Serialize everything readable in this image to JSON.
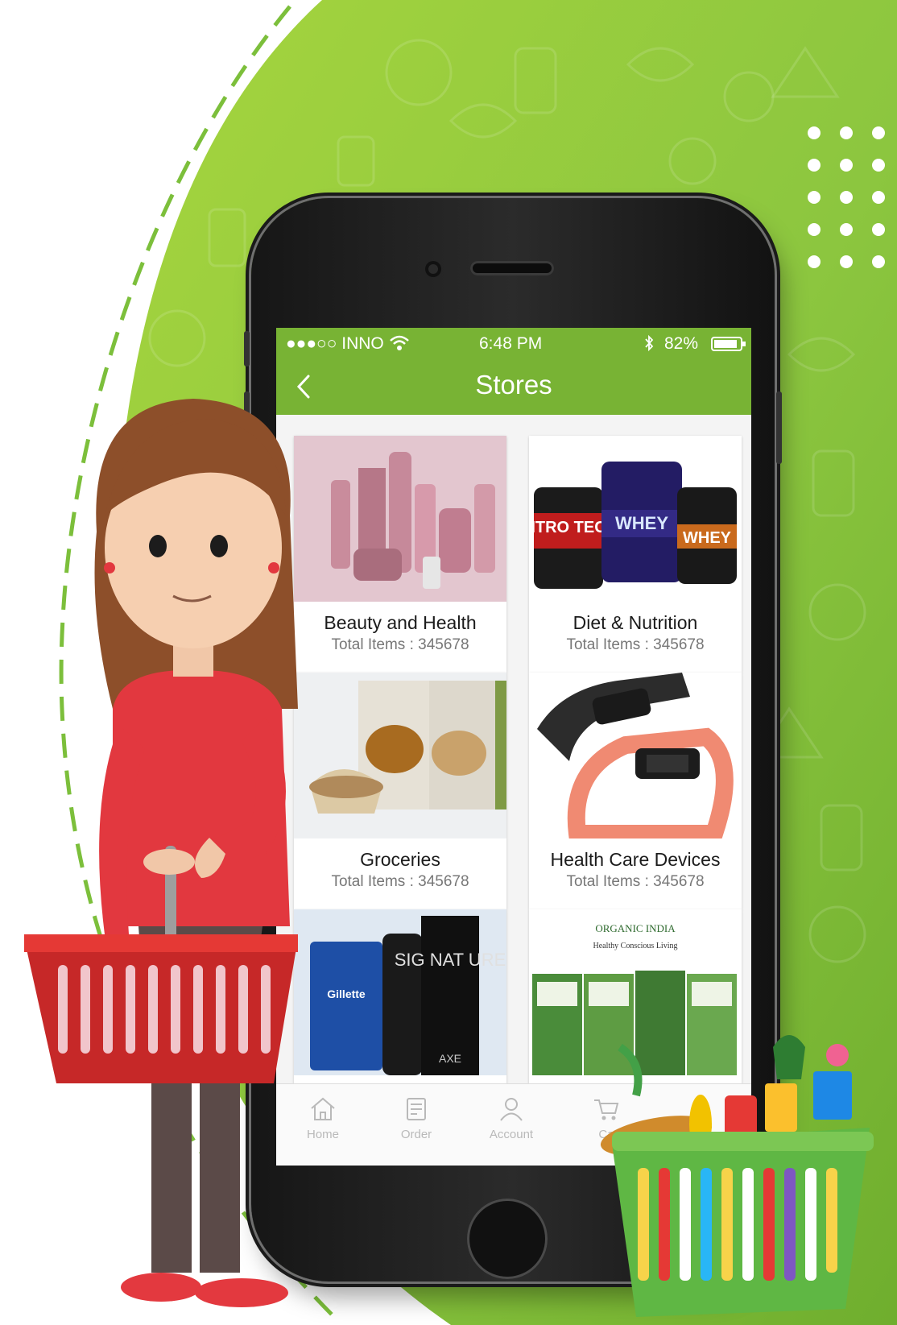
{
  "colors": {
    "brand_green": "#78b334",
    "background_green": "#8cc63f"
  },
  "status_bar": {
    "carrier": "●●●○○ INNO",
    "time": "6:48 PM",
    "battery": "82%"
  },
  "header": {
    "title": "Stores"
  },
  "stores": [
    {
      "name": "Beauty and Health",
      "count": "Total Items : 345678"
    },
    {
      "name": "Diet & Nutrition",
      "count": "Total Items : 345678"
    },
    {
      "name": "Groceries",
      "count": "Total Items : 345678"
    },
    {
      "name": "Health Care Devices",
      "count": "Total Items : 345678"
    }
  ],
  "product_labels": {
    "nitro": "NITRO TECH",
    "whey": "WHEY",
    "whey2": "WHEY",
    "signature": "SIG NAT URE",
    "axe": "AXE",
    "gillette": "Gillette",
    "organic_brand": "ORGANIC INDIA",
    "organic_tagline": "Healthy Conscious Living"
  },
  "tab_bar": {
    "home": "Home",
    "order": "Order",
    "account": "Account",
    "cart": "Ca"
  }
}
